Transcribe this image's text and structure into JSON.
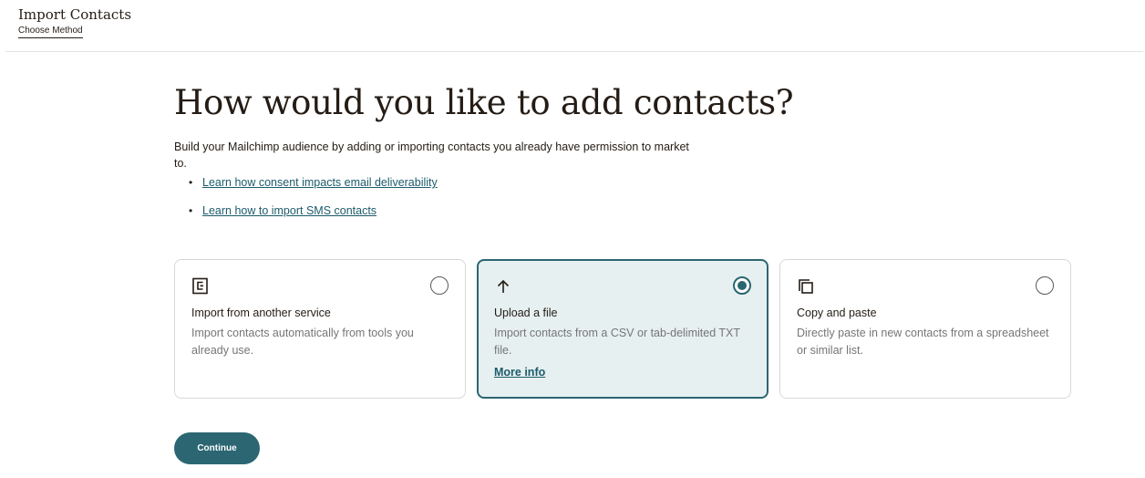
{
  "header": {
    "app_title": "Import Contacts",
    "step_label": "Choose Method"
  },
  "main": {
    "heading": "How would you like to add contacts?",
    "intro": "Build your Mailchimp audience by adding or importing contacts you already have permission to market to.",
    "links": [
      {
        "label": "Learn how consent impacts email deliverability"
      },
      {
        "label": "Learn how to import SMS contacts"
      }
    ]
  },
  "options": [
    {
      "icon": "import-service-icon",
      "title": "Import from another service",
      "description": "Import contacts automatically from tools you already use.",
      "selected": false
    },
    {
      "icon": "upload-arrow-icon",
      "title": "Upload a file",
      "description": "Import contacts from a CSV or tab-delimited TXT file.",
      "more_link": "More info",
      "selected": true
    },
    {
      "icon": "copy-icon",
      "title": "Copy and paste",
      "description": "Directly paste in new contacts from a spreadsheet or similar list.",
      "selected": false
    }
  ],
  "footer": {
    "continue_label": "Continue"
  },
  "colors": {
    "accent": "#2b6672",
    "selected_bg": "#e6f0f1",
    "link": "#1c5b6b"
  }
}
